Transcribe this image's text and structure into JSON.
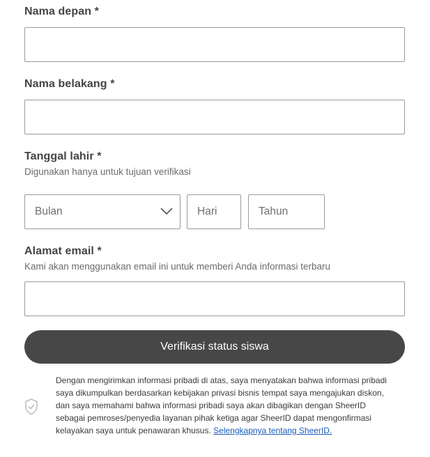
{
  "form": {
    "first_name": {
      "label": "Nama depan *",
      "value": ""
    },
    "last_name": {
      "label": "Nama belakang *",
      "value": ""
    },
    "birth_date": {
      "label": "Tanggal lahir *",
      "hint": "Digunakan hanya untuk tujuan verifikasi",
      "month_placeholder": "Bulan",
      "day_placeholder": "Hari",
      "year_placeholder": "Tahun"
    },
    "email": {
      "label": "Alamat email *",
      "hint": "Kami akan menggunakan email ini untuk memberi Anda informasi terbaru",
      "value": ""
    },
    "submit_label": "Verifikasi status siswa"
  },
  "consent": {
    "text": "Dengan mengirimkan informasi pribadi di atas, saya menyatakan bahwa informasi pribadi saya dikumpulkan berdasarkan kebijakan privasi bisnis tempat saya mengajukan diskon, dan saya memahami bahwa informasi pribadi saya akan dibagikan dengan SheerID sebagai pemroses/penyedia layanan pihak ketiga agar SheerID dapat mengonfirmasi kelayakan saya untuk penawaran khusus. ",
    "link_label": "Selengkapnya tentang SheerID."
  },
  "icons": {
    "dropdown": "chevron-down-icon",
    "consent": "shield-check-icon"
  }
}
